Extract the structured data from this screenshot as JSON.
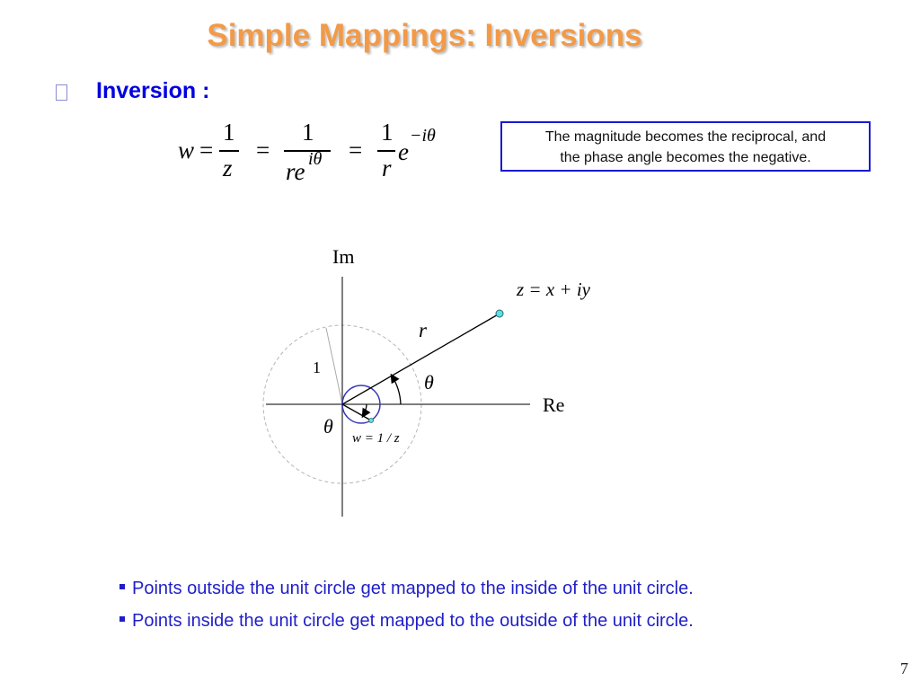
{
  "slide": {
    "title": "Simple Mappings: Inversions",
    "heading": "Inversion :",
    "heading_bullet_icon": "box-bullet-icon",
    "equation": {
      "lhs": "w",
      "eq": "=",
      "frac1_num": "1",
      "frac1_den": "z",
      "frac2_num": "1",
      "frac2_den_base": "re",
      "frac2_den_exp": "iθ",
      "frac3_num": "1",
      "frac3_den": "r",
      "tail_base": "e",
      "tail_exp": "−iθ"
    },
    "callout": {
      "line1": "The magnitude becomes the reciprocal, and",
      "line2": "the phase angle becomes the negative.",
      "border_color": "#1a1ad0"
    },
    "diagram": {
      "im_label": "Im",
      "re_label": "Re",
      "z_label": "z = x + iy",
      "r_label": "r",
      "theta_label": "θ",
      "theta_neg_label": "θ",
      "unit_radius_label": "1",
      "w_label": "w = 1 / z",
      "point_color": "#5ce0e6",
      "inverse_circle_color": "#3a3ab8"
    },
    "bullets": [
      "Points outside the unit circle get mapped to the inside of the unit circle.",
      "Points inside the unit circle get mapped to the outside of the unit circle."
    ],
    "page_number": "7"
  }
}
